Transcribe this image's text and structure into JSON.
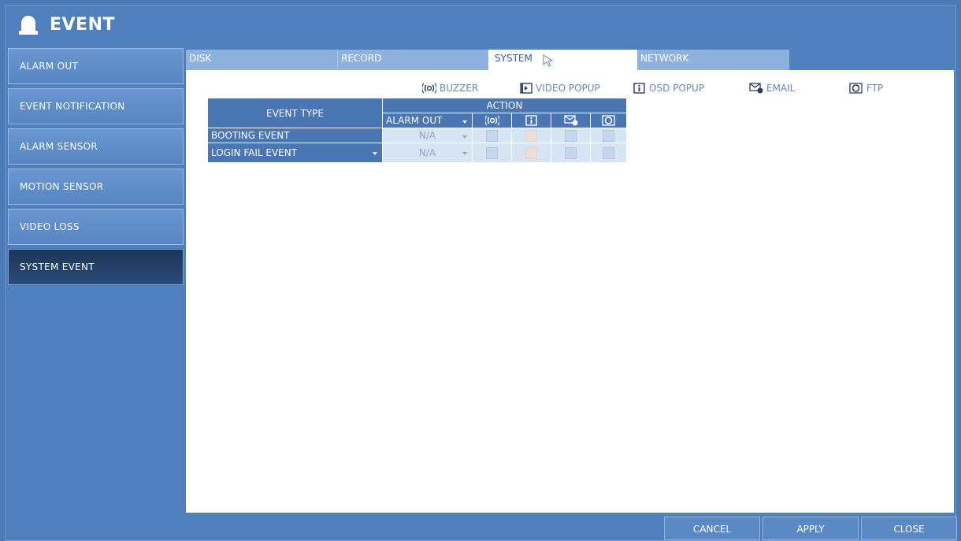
{
  "window": {
    "title": "EVENT",
    "title_icon": "alarm-bell-icon"
  },
  "sidebar": {
    "items": [
      {
        "label": "ALARM OUT"
      },
      {
        "label": "EVENT NOTIFICATION"
      },
      {
        "label": "ALARM SENSOR"
      },
      {
        "label": "MOTION SENSOR"
      },
      {
        "label": "VIDEO LOSS"
      },
      {
        "label": "SYSTEM EVENT",
        "active": true
      }
    ]
  },
  "tabs": [
    {
      "label": "DISK"
    },
    {
      "label": "RECORD"
    },
    {
      "label": "SYSTEM",
      "active": true
    },
    {
      "label": "NETWORK"
    }
  ],
  "legend": {
    "buzzer": "BUZZER",
    "video_popup": "VIDEO POPUP",
    "osd_popup": "OSD POPUP",
    "email": "EMAIL",
    "ftp": "FTP"
  },
  "table": {
    "event_type_header": "EVENT TYPE",
    "action_header": "ACTION",
    "alarm_out_header": "ALARM OUT",
    "rows": [
      {
        "event": "BOOTING EVENT",
        "alarm_out": "N/A",
        "buzzer": false,
        "osd": false,
        "email": false,
        "ftp": false
      },
      {
        "event": "LOGIN FAIL EVENT",
        "alarm_out": "N/A",
        "buzzer": false,
        "osd": false,
        "email": false,
        "ftp": false
      }
    ]
  },
  "footer": {
    "cancel": "CANCEL",
    "apply": "APPLY",
    "close": "CLOSE"
  },
  "colors": {
    "background": "#4a79b5",
    "header_cell": "#4a76b3",
    "active_item": "#1d3558",
    "tab": "#8fb1de"
  }
}
